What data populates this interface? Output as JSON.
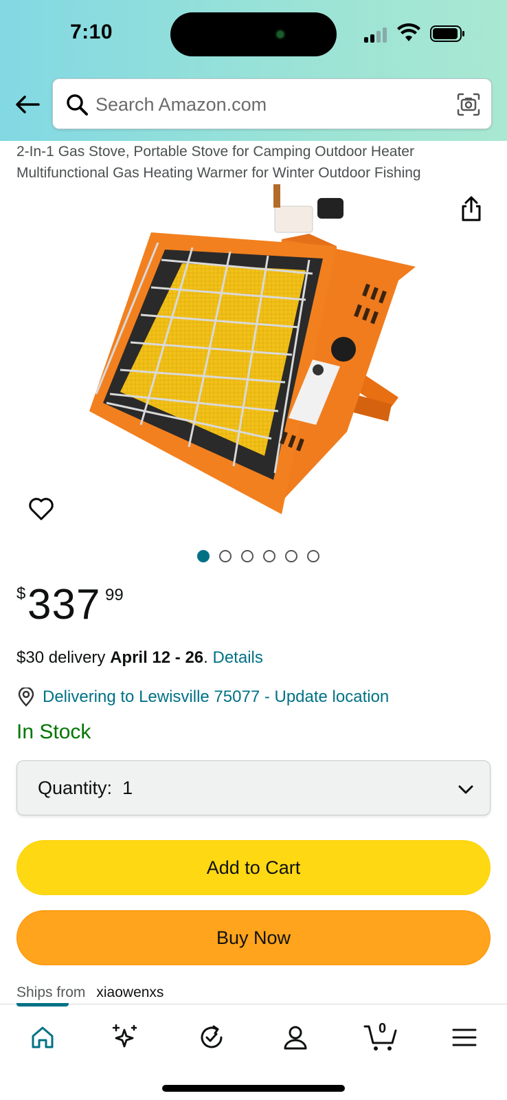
{
  "status_bar": {
    "time": "7:10"
  },
  "search": {
    "placeholder": "Search Amazon.com",
    "value": ""
  },
  "product": {
    "title": "2-In-1 Gas Stove, Portable Stove for Camping Outdoor Heater Multifunctional Gas Heating Warmer for Winter Outdoor Fishing",
    "image_count": 6,
    "active_image_index": 0,
    "price": {
      "symbol": "$",
      "whole": "337",
      "fraction": "99"
    },
    "delivery": {
      "prefix": "$30 delivery",
      "dates": "April 12 - 26",
      "separator": ".",
      "details_link": "Details"
    },
    "location": "Delivering to Lewisville 75077 - Update location",
    "stock": "In Stock",
    "quantity": {
      "label": "Quantity:",
      "value": "1"
    },
    "add_to_cart_label": "Add to Cart",
    "buy_now_label": "Buy Now",
    "ships_from": {
      "label": "Ships from",
      "value": "xiaowenxs"
    }
  },
  "bottom_nav": {
    "items": [
      "home",
      "ai-assistant",
      "buy-again",
      "account",
      "cart",
      "menu"
    ],
    "active": "home",
    "cart_count": "0"
  },
  "colors": {
    "header_gradient_start": "#82d8e3",
    "header_gradient_end": "#a9e8d2",
    "link": "#007185",
    "in_stock": "#007600",
    "add_to_cart": "#ffd814",
    "buy_now": "#ffa41c",
    "product_orange": "#f07c1e",
    "heating_element_yellow": "#f2c21b"
  }
}
